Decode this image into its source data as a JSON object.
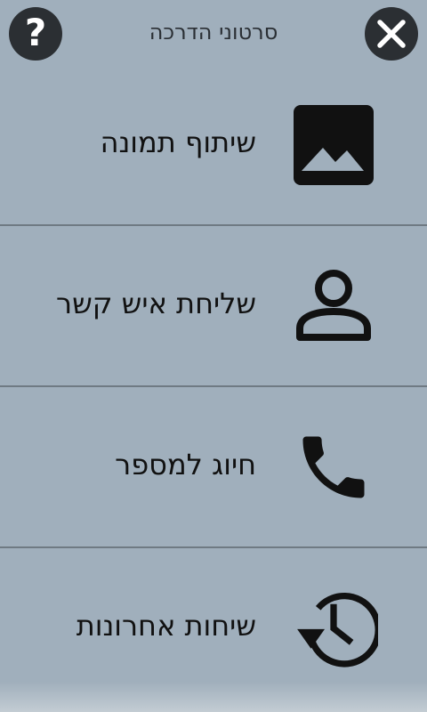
{
  "header": {
    "title": "סרטוני הדרכה",
    "help_label": "?",
    "help_icon": "help-icon",
    "close_icon": "close-icon"
  },
  "items": [
    {
      "label": "שיתוף תמונה",
      "icon": "image-icon"
    },
    {
      "label": "שליחת איש קשר",
      "icon": "person-icon"
    },
    {
      "label": "חיוג למספר",
      "icon": "phone-icon"
    },
    {
      "label": "שיחות אחרונות",
      "icon": "history-icon"
    }
  ],
  "colors": {
    "background": "#a0afbc",
    "divider": "#6f7a83",
    "button": "#2b2f33",
    "text": "#111111"
  }
}
